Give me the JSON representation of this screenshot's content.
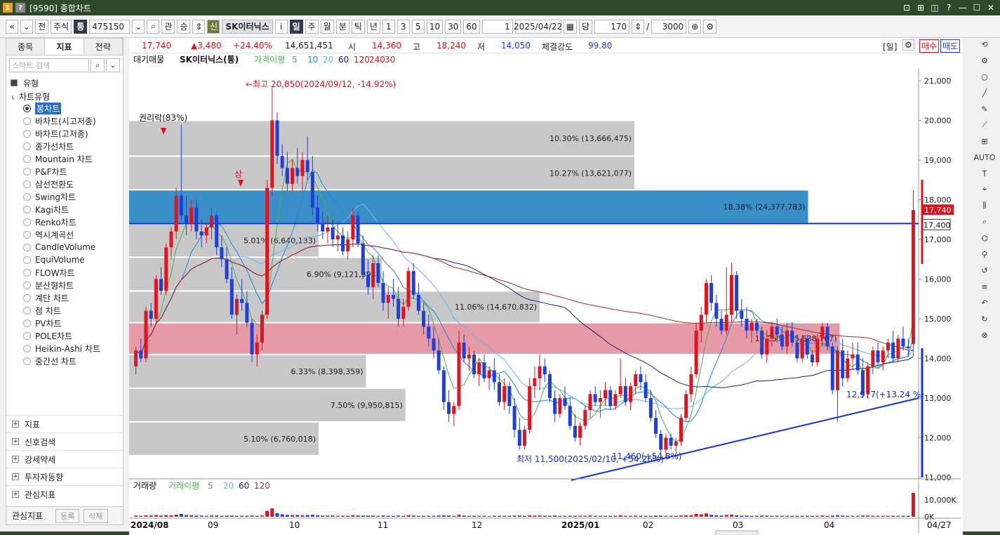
{
  "window": {
    "badge1": "1",
    "badge2": "?",
    "title": "[9590] 종합차트",
    "controls": [
      "⊡",
      "⊞",
      "◫",
      "?",
      "—",
      "☐",
      "✕"
    ]
  },
  "toolbar": {
    "nav_prev": "«",
    "nav_down": "⌄",
    "prev": "전",
    "market": "주식",
    "tong": "통",
    "code": "475150",
    "search": "⌕",
    "gwan": "관",
    "seung": "승",
    "updown": "⇕",
    "shin": "신",
    "stock_name": "SK이터닉스",
    "info": "i",
    "periods": [
      "일",
      "주",
      "월",
      "분",
      "틱",
      "년"
    ],
    "active_period": "일",
    "nums": [
      "1",
      "3",
      "5",
      "10",
      "30",
      "60"
    ],
    "unit_value": "1",
    "date": "2025/04/22",
    "dang": "당",
    "count": "170",
    "slash": "/",
    "total": "3000",
    "zoom": "⊕",
    "gear": "⚙"
  },
  "left_panel": {
    "tabs": [
      "종목",
      "지표",
      "전략"
    ],
    "active_tab": "지표",
    "search_placeholder": "스마트 검색",
    "section": "유형",
    "subsection": "차트유형",
    "chart_types": [
      "봉차트",
      "바차트(시고저종)",
      "바차트(고저종)",
      "종가선차트",
      "Mountain 차트",
      "P&F차트",
      "삼선전환도",
      "Swing차트",
      "Kagi차트",
      "Renko차트",
      "역시계곡선",
      "CandleVolume",
      "EquiVolume",
      "FLOW차트",
      "분산형차트",
      "계단 차트",
      "점 차트",
      "PV차트",
      "POLE차트",
      "Heikin-Ashi 차트",
      "중간선 차트"
    ],
    "selected": "봉차트",
    "groups": [
      "지표",
      "신호검색",
      "강세약세",
      "투자자동향",
      "관심지표"
    ],
    "bottom": {
      "label": "관심지표",
      "register": "등록",
      "delete": "삭제"
    }
  },
  "infobar": {
    "price": "17,740",
    "change": "▲3,480",
    "pct": "+24.40%",
    "volume": "14,651,451",
    "open_label": "시",
    "open": "14,360",
    "high_label": "고",
    "high": "18,240",
    "low_label": "저",
    "low": "14,050",
    "strength_label": "체결강도",
    "strength": "99.80",
    "period_tag": "[일]",
    "buy": "매수",
    "sell": "매도"
  },
  "colors": {
    "up": "#e0141e",
    "down": "#1e3fd8",
    "band_blue": "#3b8fc8",
    "band_pink": "#e69aa6",
    "band_gray": "#c8c8c8"
  },
  "chart_data": {
    "type": "candlestick",
    "legend": {
      "title": "대기매물",
      "stock": "SK이터닉스(통)",
      "ma_title": "가격이평",
      "ma": [
        "5",
        "10",
        "20",
        "60",
        "120",
        "240",
        "30"
      ]
    },
    "volume_legend": {
      "title": "거래량",
      "ma_title": "거래이평",
      "ma": [
        "5",
        "20",
        "60",
        "120"
      ]
    },
    "y_ticks": [
      "21,000",
      "20,000",
      "19,000",
      "18,000",
      "17,000",
      "16,000",
      "15,000",
      "14,000",
      "13,000",
      "12,000",
      "11,000"
    ],
    "y_range": [
      11000,
      21300
    ],
    "vol_ticks": [
      "10,000K",
      "0K"
    ],
    "x_labels": [
      "2024/08",
      "09",
      "10",
      "11",
      "12",
      "2025/01",
      "02",
      "03",
      "04"
    ],
    "x_end": "04/27",
    "volume_profile": [
      {
        "label": "10.30% (13,666,475)",
        "lo": 19100,
        "hi": 20000,
        "frac": 0.64
      },
      {
        "label": "10.27% (13,621,077)",
        "lo": 18250,
        "hi": 19100,
        "frac": 0.64
      },
      {
        "label": "18.38% (24,377,783)",
        "lo": 17400,
        "hi": 18250,
        "frac": 0.86
      },
      {
        "label": "5.01% (6,640,133)",
        "lo": 16550,
        "hi": 17400,
        "frac": 0.24
      },
      {
        "label": "6.90% (9,121,393)",
        "lo": 15700,
        "hi": 16550,
        "frac": 0.32
      },
      {
        "label": "11.06% (14,670,832)",
        "lo": 14900,
        "hi": 15700,
        "frac": 0.52
      },
      {
        "label": "19.25% (25,538,767)",
        "lo": 14100,
        "hi": 14900,
        "frac": 0.9
      },
      {
        "label": "6.33% (8,398,359)",
        "lo": 13250,
        "hi": 14100,
        "frac": 0.3
      },
      {
        "label": "7.50% (9,950,815)",
        "lo": 12400,
        "hi": 13250,
        "frac": 0.35
      },
      {
        "label": "5.10% (6,760,018)",
        "lo": 11550,
        "hi": 12400,
        "frac": 0.24
      }
    ],
    "highlight_blue": {
      "lo": 17400,
      "hi": 18250
    },
    "highlight_pink": {
      "lo": 14100,
      "hi": 14900
    },
    "annotations": {
      "rights": "권리락(83%)",
      "limit_up": "상",
      "max": "←최고 20,850(2024/09/12, -14.92%)",
      "min": "최저 11,500(2025/02/10, +54.26%)",
      "low_right": "11,460(+54.8%)",
      "trend_label": "12,977(+13.24 %)"
    },
    "price_tags": {
      "current": "17,740",
      "line": "17,400",
      "side": "+24.40%"
    },
    "h_line": 17400,
    "candles": [
      [
        13800,
        14300,
        13600,
        14200
      ],
      [
        14200,
        14500,
        13900,
        14000
      ],
      [
        14000,
        15300,
        13900,
        15200
      ],
      [
        15200,
        15400,
        14800,
        15000
      ],
      [
        15000,
        16100,
        14900,
        16000
      ],
      [
        16000,
        16300,
        15600,
        15700
      ],
      [
        15700,
        16900,
        15600,
        16800
      ],
      [
        16800,
        17300,
        16500,
        17200
      ],
      [
        17200,
        18300,
        17000,
        18100
      ],
      [
        18100,
        19900,
        17500,
        17600
      ],
      [
        17600,
        18100,
        17100,
        17400
      ],
      [
        17400,
        18000,
        17200,
        17800
      ],
      [
        17800,
        18000,
        17000,
        17200
      ],
      [
        17200,
        17500,
        16800,
        17100
      ],
      [
        17100,
        17400,
        16900,
        17300
      ],
      [
        17300,
        17800,
        17000,
        17600
      ],
      [
        17600,
        17700,
        16600,
        16800
      ],
      [
        16800,
        17100,
        16300,
        16500
      ],
      [
        16500,
        16800,
        15900,
        16000
      ],
      [
        16000,
        16300,
        15000,
        15100
      ],
      [
        15100,
        15600,
        14600,
        15500
      ],
      [
        15500,
        16000,
        15200,
        15400
      ],
      [
        15400,
        15700,
        14800,
        14900
      ],
      [
        14900,
        15000,
        13900,
        14100
      ],
      [
        14100,
        14600,
        13800,
        14400
      ],
      [
        14400,
        15200,
        14200,
        15100
      ],
      [
        15100,
        18500,
        15000,
        18300
      ],
      [
        18300,
        20850,
        18100,
        20000
      ],
      [
        20000,
        20200,
        18900,
        19100
      ],
      [
        19100,
        19400,
        18600,
        18800
      ],
      [
        18800,
        19200,
        18200,
        18400
      ],
      [
        18400,
        19000,
        18200,
        18800
      ],
      [
        18800,
        19300,
        18400,
        18600
      ],
      [
        18600,
        19200,
        18200,
        19000
      ],
      [
        19000,
        19600,
        18500,
        18700
      ],
      [
        18700,
        19100,
        17600,
        17800
      ],
      [
        17800,
        18100,
        17200,
        17400
      ],
      [
        17400,
        17700,
        17000,
        17200
      ],
      [
        17200,
        17600,
        16900,
        17300
      ],
      [
        17300,
        17500,
        16800,
        17000
      ],
      [
        17000,
        17400,
        16700,
        17100
      ],
      [
        17100,
        17300,
        16600,
        16700
      ],
      [
        16700,
        17200,
        16500,
        17000
      ],
      [
        17000,
        17800,
        16800,
        17600
      ],
      [
        17600,
        17700,
        16800,
        16900
      ],
      [
        16900,
        17100,
        16000,
        16100
      ],
      [
        16100,
        16500,
        15600,
        15800
      ],
      [
        15800,
        16600,
        15500,
        16400
      ],
      [
        16400,
        16600,
        15800,
        15900
      ],
      [
        15900,
        16200,
        15200,
        15400
      ],
      [
        15400,
        15800,
        15000,
        15600
      ],
      [
        15600,
        16000,
        15300,
        15500
      ],
      [
        15500,
        15800,
        14800,
        15000
      ],
      [
        15000,
        15500,
        14800,
        15300
      ],
      [
        15300,
        16300,
        15200,
        16200
      ],
      [
        16200,
        16400,
        15500,
        15600
      ],
      [
        15600,
        15900,
        15100,
        15200
      ],
      [
        15200,
        15400,
        14600,
        14800
      ],
      [
        14800,
        15100,
        14300,
        14500
      ],
      [
        14500,
        14800,
        14000,
        14200
      ],
      [
        14200,
        14500,
        13600,
        13700
      ],
      [
        13700,
        13800,
        12700,
        12900
      ],
      [
        12900,
        13200,
        12400,
        12600
      ],
      [
        12600,
        12900,
        12300,
        12800
      ],
      [
        12800,
        14700,
        12700,
        14400
      ],
      [
        14400,
        14600,
        13900,
        14000
      ],
      [
        14000,
        14300,
        13700,
        14100
      ],
      [
        14100,
        14200,
        13500,
        13600
      ],
      [
        13600,
        14000,
        13300,
        13900
      ],
      [
        13900,
        14100,
        13400,
        13500
      ],
      [
        13500,
        13800,
        13200,
        13700
      ],
      [
        13700,
        14000,
        13200,
        13400
      ],
      [
        13400,
        13600,
        12800,
        12900
      ],
      [
        12900,
        13500,
        12700,
        13300
      ],
      [
        13300,
        13400,
        12600,
        12800
      ],
      [
        12800,
        13000,
        12000,
        12200
      ],
      [
        12200,
        12500,
        11700,
        11800
      ],
      [
        11800,
        12300,
        11700,
        12200
      ],
      [
        12200,
        13500,
        12100,
        13300
      ],
      [
        13300,
        13800,
        13000,
        13500
      ],
      [
        13500,
        14100,
        13200,
        13800
      ],
      [
        13800,
        14000,
        13400,
        13600
      ],
      [
        13600,
        13700,
        12900,
        13000
      ],
      [
        13000,
        13200,
        12400,
        12600
      ],
      [
        12600,
        13100,
        12500,
        13000
      ],
      [
        13000,
        13300,
        12700,
        12800
      ],
      [
        12800,
        13000,
        12200,
        12300
      ],
      [
        12300,
        12600,
        11900,
        12000
      ],
      [
        12000,
        12400,
        11800,
        12300
      ],
      [
        12300,
        12800,
        12200,
        12700
      ],
      [
        12700,
        13200,
        12500,
        13100
      ],
      [
        13100,
        13300,
        12800,
        12900
      ],
      [
        12900,
        13200,
        12500,
        13000
      ],
      [
        13000,
        13400,
        12800,
        13200
      ],
      [
        13200,
        13300,
        12700,
        12800
      ],
      [
        12800,
        13200,
        12700,
        13100
      ],
      [
        13100,
        14000,
        13000,
        13300
      ],
      [
        13300,
        13500,
        12800,
        12900
      ],
      [
        12900,
        13400,
        12700,
        13300
      ],
      [
        13300,
        13700,
        13100,
        13600
      ],
      [
        13600,
        13800,
        13200,
        13400
      ],
      [
        13400,
        13600,
        12900,
        13000
      ],
      [
        13000,
        13200,
        12400,
        12500
      ],
      [
        12500,
        12700,
        12000,
        12100
      ],
      [
        12100,
        12200,
        11600,
        11700
      ],
      [
        11700,
        12100,
        11500,
        12000
      ],
      [
        12000,
        12100,
        11700,
        11800
      ],
      [
        11800,
        12000,
        11600,
        11900
      ],
      [
        11900,
        12600,
        11800,
        12500
      ],
      [
        12500,
        13200,
        12400,
        13100
      ],
      [
        13100,
        13800,
        12900,
        13600
      ],
      [
        13600,
        14900,
        13500,
        14700
      ],
      [
        14700,
        15300,
        14400,
        15100
      ],
      [
        15100,
        16000,
        14900,
        15900
      ],
      [
        15900,
        16100,
        15200,
        15400
      ],
      [
        15400,
        15600,
        14800,
        15000
      ],
      [
        15000,
        15200,
        14600,
        14700
      ],
      [
        14700,
        16300,
        14600,
        15100
      ],
      [
        15100,
        16400,
        14900,
        16100
      ],
      [
        16100,
        16200,
        15000,
        15200
      ],
      [
        15200,
        15500,
        14800,
        15000
      ],
      [
        15000,
        15300,
        14500,
        14700
      ],
      [
        14700,
        15000,
        14400,
        14900
      ],
      [
        14900,
        15000,
        14600,
        14700
      ],
      [
        14700,
        14800,
        14000,
        14100
      ],
      [
        14100,
        14700,
        13900,
        14500
      ],
      [
        14500,
        14900,
        14300,
        14800
      ],
      [
        14800,
        15000,
        14400,
        14600
      ],
      [
        14600,
        14800,
        14200,
        14300
      ],
      [
        14300,
        14900,
        14100,
        14700
      ],
      [
        14700,
        14900,
        14300,
        14400
      ],
      [
        14400,
        14600,
        13900,
        14000
      ],
      [
        14000,
        14600,
        13900,
        14500
      ],
      [
        14500,
        14600,
        14000,
        14100
      ],
      [
        14100,
        14200,
        13800,
        13900
      ],
      [
        13900,
        14600,
        13800,
        14500
      ],
      [
        14500,
        14900,
        14300,
        14800
      ],
      [
        14800,
        14900,
        14200,
        14300
      ],
      [
        14300,
        14400,
        13100,
        13200
      ],
      [
        13200,
        14300,
        12400,
        14200
      ],
      [
        14200,
        14500,
        13300,
        13500
      ],
      [
        13500,
        14200,
        13400,
        14000
      ],
      [
        14000,
        14400,
        13700,
        14100
      ],
      [
        14100,
        14400,
        13600,
        13700
      ],
      [
        13700,
        14000,
        13000,
        13100
      ],
      [
        13100,
        13900,
        12977,
        13800
      ],
      [
        13800,
        14300,
        13600,
        14200
      ],
      [
        14200,
        14400,
        13800,
        13900
      ],
      [
        13900,
        14300,
        13700,
        14200
      ],
      [
        14200,
        14500,
        14000,
        14400
      ],
      [
        14400,
        14700,
        13900,
        14000
      ],
      [
        14000,
        14600,
        13900,
        14500
      ],
      [
        14500,
        14800,
        14200,
        14300
      ],
      [
        14300,
        14500,
        14050,
        14260
      ],
      [
        14360,
        18240,
        14050,
        17740
      ]
    ],
    "volumes": [
      0.05,
      0.04,
      0.06,
      0.05,
      0.07,
      0.05,
      0.07,
      0.06,
      0.09,
      0.12,
      0.07,
      0.06,
      0.05,
      0.05,
      0.04,
      0.05,
      0.05,
      0.04,
      0.05,
      0.05,
      0.04,
      0.04,
      0.04,
      0.05,
      0.04,
      0.05,
      0.25,
      0.35,
      0.15,
      0.1,
      0.08,
      0.07,
      0.07,
      0.06,
      0.07,
      0.08,
      0.06,
      0.05,
      0.05,
      0.05,
      0.04,
      0.04,
      0.04,
      0.06,
      0.05,
      0.05,
      0.05,
      0.05,
      0.04,
      0.05,
      0.04,
      0.04,
      0.05,
      0.04,
      0.06,
      0.05,
      0.04,
      0.04,
      0.04,
      0.04,
      0.05,
      0.06,
      0.05,
      0.04,
      0.08,
      0.05,
      0.04,
      0.04,
      0.04,
      0.04,
      0.03,
      0.04,
      0.04,
      0.04,
      0.04,
      0.05,
      0.05,
      0.04,
      0.06,
      0.05,
      0.05,
      0.04,
      0.04,
      0.05,
      0.04,
      0.04,
      0.04,
      0.04,
      0.04,
      0.04,
      0.05,
      0.04,
      0.04,
      0.04,
      0.04,
      0.04,
      0.06,
      0.04,
      0.04,
      0.05,
      0.04,
      0.04,
      0.04,
      0.05,
      0.05,
      0.04,
      0.04,
      0.04,
      0.05,
      0.06,
      0.07,
      0.12,
      0.1,
      0.14,
      0.08,
      0.06,
      0.05,
      0.08,
      0.09,
      0.06,
      0.05,
      0.05,
      0.04,
      0.04,
      0.05,
      0.05,
      0.04,
      0.04,
      0.04,
      0.04,
      0.04,
      0.04,
      0.04,
      0.04,
      0.04,
      0.04,
      0.05,
      0.04,
      0.05,
      0.06,
      0.05,
      0.04,
      0.04,
      0.04,
      0.05,
      0.05,
      0.04,
      0.04,
      0.04,
      0.04,
      0.04,
      0.04,
      0.04,
      0.04,
      1.0
    ]
  },
  "scrollbar": {
    "left": "◂",
    "right": "▸"
  },
  "right_tools": [
    "⟲",
    "⚙",
    "○",
    "╱",
    "✎",
    "⟋",
    "⊞",
    "AUTO",
    "T",
    "⌖",
    "⫼",
    "⌕",
    "⌬",
    "⚲",
    "↺",
    "≡",
    "↶",
    "↻",
    "⊗"
  ]
}
